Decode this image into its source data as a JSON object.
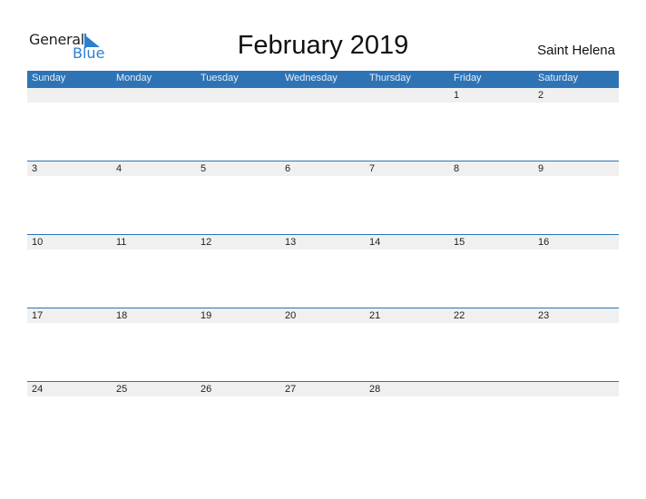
{
  "logo": {
    "general": "General",
    "blue": "Blue",
    "brand_color": "#2e7fd0"
  },
  "title": "February 2019",
  "region": "Saint Helena",
  "header_color": "#2e74b5",
  "weekdays": [
    "Sunday",
    "Monday",
    "Tuesday",
    "Wednesday",
    "Thursday",
    "Friday",
    "Saturday"
  ],
  "weeks": [
    [
      "",
      "",
      "",
      "",
      "",
      "1",
      "2"
    ],
    [
      "3",
      "4",
      "5",
      "6",
      "7",
      "8",
      "9"
    ],
    [
      "10",
      "11",
      "12",
      "13",
      "14",
      "15",
      "16"
    ],
    [
      "17",
      "18",
      "19",
      "20",
      "21",
      "22",
      "23"
    ],
    [
      "24",
      "25",
      "26",
      "27",
      "28",
      "",
      ""
    ]
  ]
}
